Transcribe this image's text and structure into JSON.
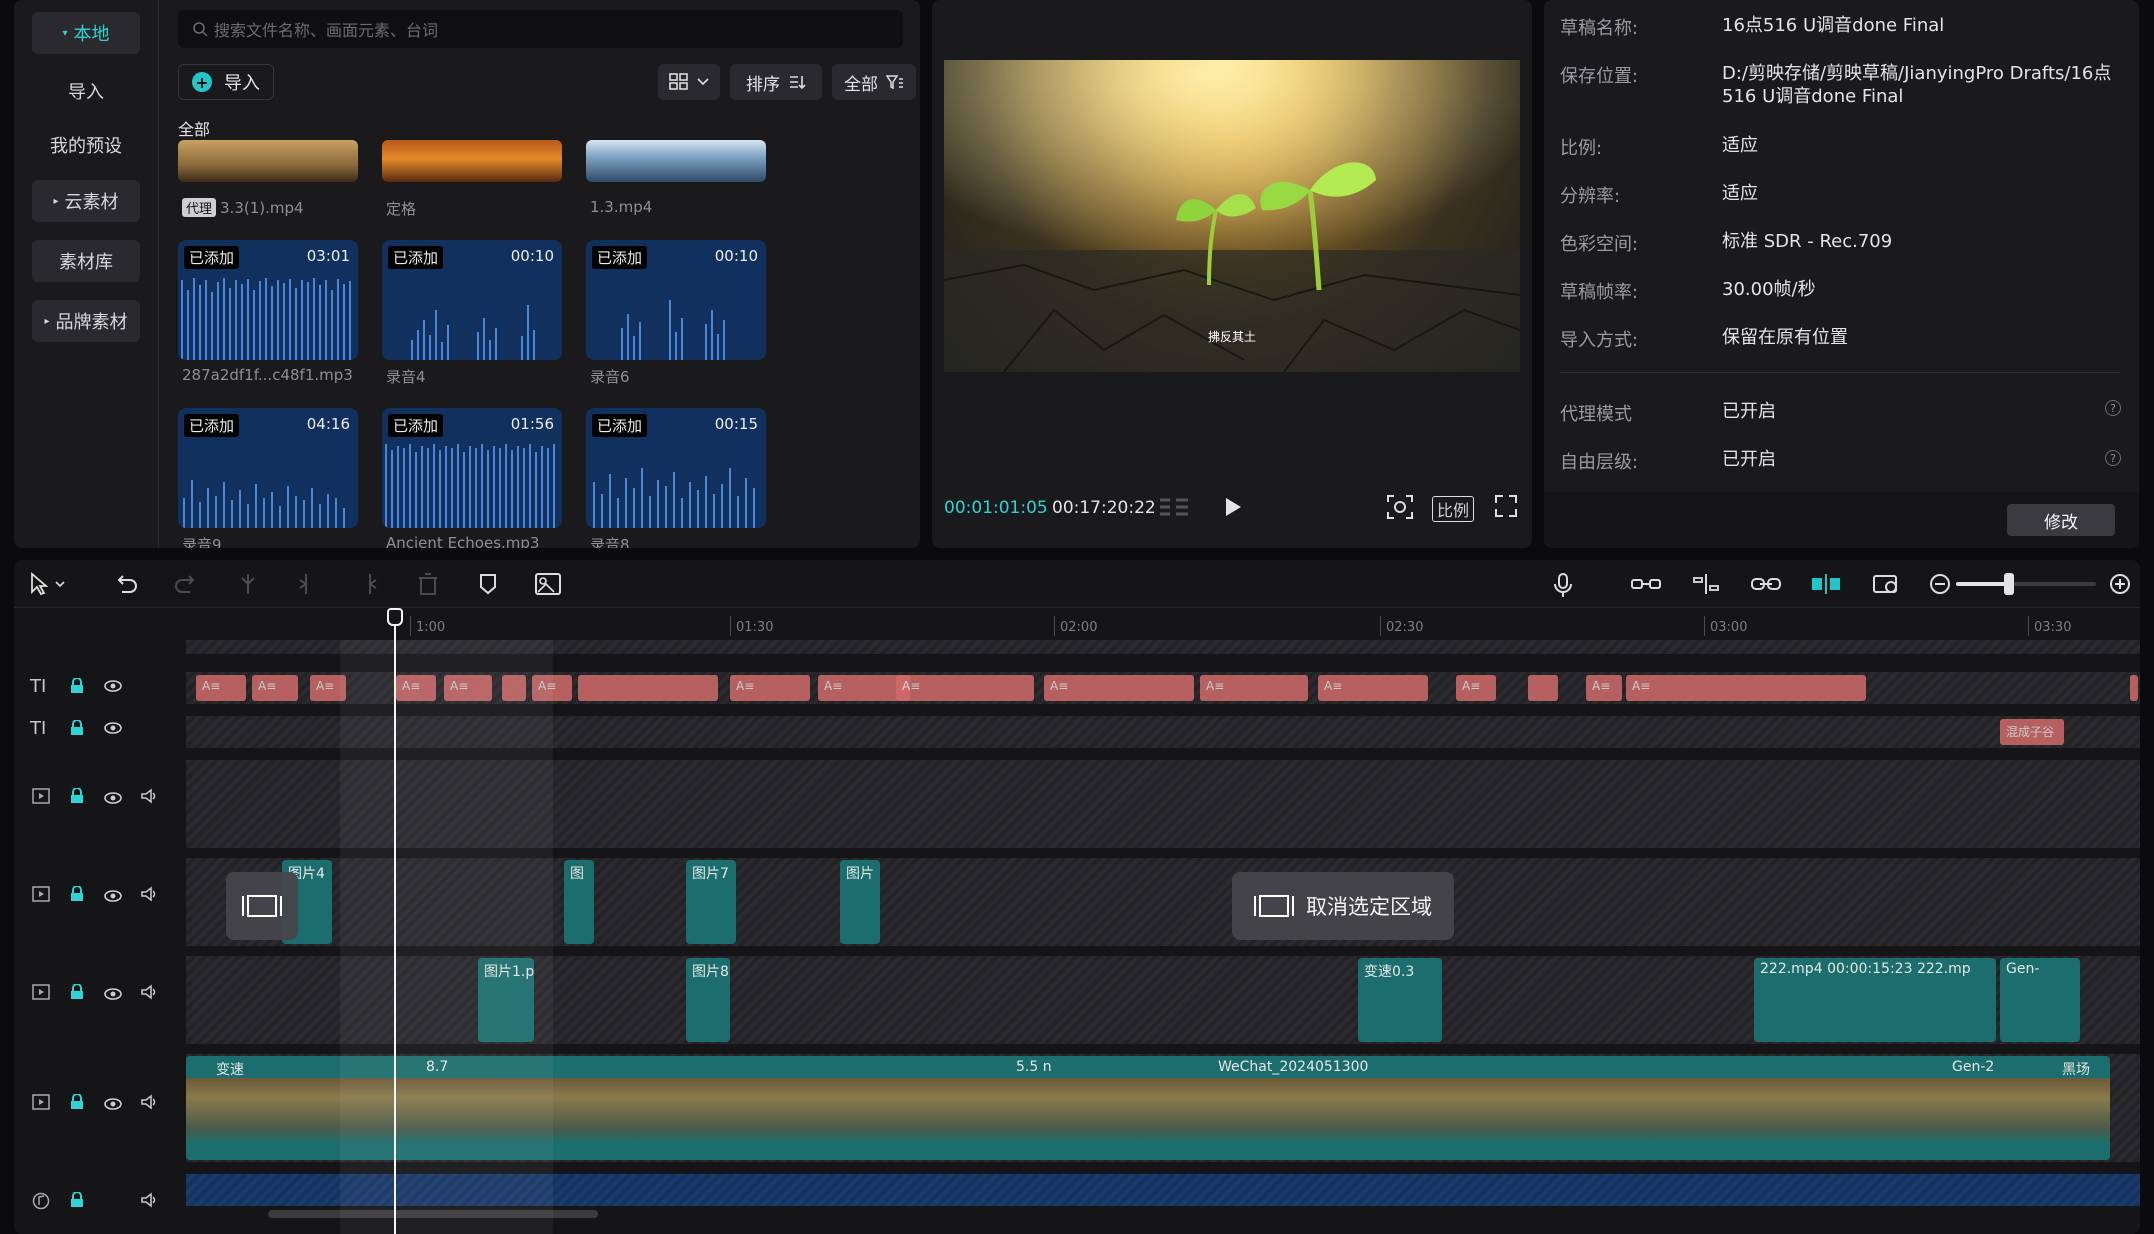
{
  "nav": {
    "local": "本地",
    "import": "导入",
    "presets": "我的预设",
    "cloud": "云素材",
    "library": "素材库",
    "brand": "品牌素材"
  },
  "media": {
    "search_placeholder": "搜索文件名称、画面元素、台词",
    "import_label": "导入",
    "sort_label": "排序",
    "filter_label": "全部",
    "all_label": "全部",
    "proxy_tag": "代理",
    "added_tag": "已添加",
    "videos": [
      {
        "name": "3.3(1).mp4"
      },
      {
        "name": "定格"
      },
      {
        "name": "1.3.mp4"
      }
    ],
    "audios": [
      {
        "name": "287a2df1f...c48f1.mp3",
        "duration": "03:01"
      },
      {
        "name": "录音4",
        "duration": "00:10"
      },
      {
        "name": "录音6",
        "duration": "00:10"
      },
      {
        "name": "录音9",
        "duration": "04:16"
      },
      {
        "name": "Ancient Echoes.mp3",
        "duration": "01:56"
      },
      {
        "name": "录音8",
        "duration": "00:15"
      }
    ]
  },
  "player": {
    "subtitle": "拂反其土",
    "current_time": "00:01:01:05",
    "total_time": "00:17:20:22",
    "ratio_label": "比例"
  },
  "info": {
    "rows": [
      {
        "k": "草稿名称:",
        "v": "16点516 U调音done Final"
      },
      {
        "k": "保存位置:",
        "v": "D:/剪映存储/剪映草稿/JianyingPro Drafts/16点516 U调音done Final"
      },
      {
        "k": "比例:",
        "v": "适应"
      },
      {
        "k": "分辨率:",
        "v": "适应"
      },
      {
        "k": "色彩空间:",
        "v": "标准 SDR - Rec.709"
      },
      {
        "k": "草稿帧率:",
        "v": "30.00帧/秒"
      },
      {
        "k": "导入方式:",
        "v": "保留在原有位置"
      },
      {
        "k": "代理模式",
        "v": "已开启"
      },
      {
        "k": "自由层级:",
        "v": "已开启"
      }
    ],
    "modify_label": "修改"
  },
  "timeline": {
    "ticks": [
      "1:00",
      "01:30",
      "02:00",
      "02:30",
      "03:00",
      "03:30"
    ],
    "deselect_label": "取消选定区域",
    "text_track_label": "TI",
    "text_clip_label": "A≡",
    "text_clip_end": "混成子谷",
    "clips": {
      "img4": "图片4",
      "img7": "图片7",
      "img8": "图片8",
      "img1": "图片1.p",
      "img_short": "图",
      "img_end": "图片",
      "speed": "变速0.3",
      "mp4_222": "222.mp4",
      "mp4_222_time": "00:00:15:23",
      "mp4_222b": "222.mp",
      "gen": "Gen-",
      "wechat": "WeChat_2024051300",
      "speed_main": "变速",
      "five": "5.5 n",
      "eight": "8.7",
      "gen2": "Gen-2",
      "blackfield": "黑场"
    }
  },
  "colors": {
    "accent": "#2ed3d4",
    "audio_bg": "#12305e",
    "text_clip": "#d06a6a",
    "video_clip": "#1c6e6e"
  }
}
